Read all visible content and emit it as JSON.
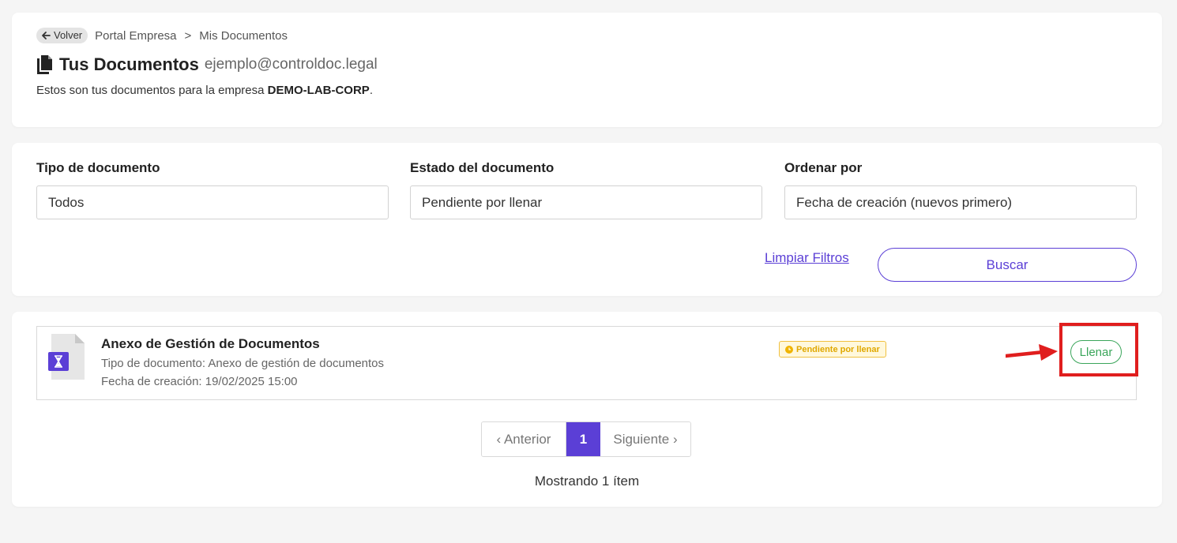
{
  "header": {
    "back_label": "Volver",
    "breadcrumb": [
      "Portal Empresa",
      "Mis Documentos"
    ],
    "breadcrumb_separator": ">",
    "title": "Tus Documentos",
    "email": "ejemplo@controldoc.legal",
    "subtitle_prefix": "Estos son tus documentos para la empresa ",
    "company": "DEMO-LAB-CORP",
    "subtitle_suffix": "."
  },
  "filters": {
    "doc_type": {
      "label": "Tipo de documento",
      "value": "Todos"
    },
    "doc_status": {
      "label": "Estado del documento",
      "value": "Pendiente por llenar"
    },
    "order_by": {
      "label": "Ordenar por",
      "value": "Fecha de creación (nuevos primero)"
    },
    "clear_label": "Limpiar Filtros",
    "search_label": "Buscar"
  },
  "documents": [
    {
      "name": "Anexo de Gestión de Documentos",
      "type_line": "Tipo de documento: Anexo de gestión de documentos",
      "date_line": "Fecha de creación: 19/02/2025 15:00",
      "status": "Pendiente por llenar",
      "action_label": "Llenar"
    }
  ],
  "pagination": {
    "prev_label": "‹ Anterior",
    "current_page": "1",
    "next_label": "Siguiente ›",
    "summary": "Mostrando 1 ítem"
  },
  "colors": {
    "accent": "#5b3fd6",
    "success": "#3aa55a",
    "warning": "#f0b400",
    "highlight": "#e01e1e"
  },
  "icons": {
    "back": "arrow-left-icon",
    "title": "documents-icon",
    "document": "file-hourglass-icon",
    "status": "clock-icon",
    "annotation": "red-arrow"
  }
}
